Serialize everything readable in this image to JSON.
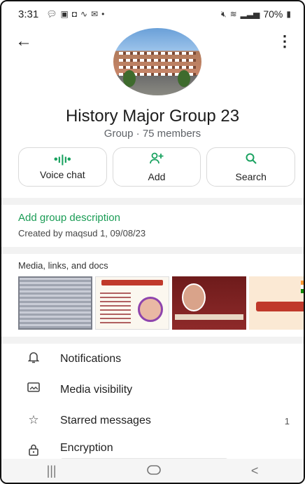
{
  "status_bar": {
    "time": "3:31",
    "notification_icons": [
      "chat-icon",
      "gallery-icon",
      "message-icon",
      "wifi-calling-icon",
      "mail-icon"
    ],
    "system_icons": [
      "mute-icon",
      "wifi-icon",
      "signal-icon"
    ],
    "battery": "70%"
  },
  "header": {
    "back_icon": "arrow-left-icon",
    "more_icon": "more-vertical-icon"
  },
  "group": {
    "name": "History Major Group 23",
    "info": "Group · 75 members"
  },
  "actions": [
    {
      "icon": "voice-wave-icon",
      "glyph": "•ı|ı•",
      "label": "Voice chat"
    },
    {
      "icon": "add-person-icon",
      "glyph": "+",
      "label": "Add"
    },
    {
      "icon": "search-icon",
      "glyph": "⚲",
      "label": "Search"
    }
  ],
  "description": {
    "link": "Add group description",
    "created": "Created by maqsud 1, 09/08/23"
  },
  "media": {
    "title": "Media, links, and docs",
    "thumbnails": [
      {
        "kind": "scanned-document"
      },
      {
        "kind": "poster",
        "caption": "Karim City College"
      },
      {
        "kind": "poster",
        "caption": "DR. JINDASI KUMARI"
      },
      {
        "kind": "poster"
      }
    ]
  },
  "settings": [
    {
      "icon": "bell-icon",
      "glyph": "🔔︎",
      "label": "Notifications",
      "count": ""
    },
    {
      "icon": "image-icon",
      "glyph": "▭",
      "label": "Media visibility",
      "count": ""
    },
    {
      "icon": "star-icon",
      "glyph": "☆",
      "label": "Starred messages",
      "count": "1"
    },
    {
      "icon": "lock-icon",
      "glyph": "🔒︎",
      "label": "Encryption",
      "count": ""
    }
  ],
  "nav": {
    "recents": "|||",
    "home": "○",
    "back": "<"
  },
  "colors": {
    "accent_green": "#1a9c55",
    "icon_green": "#1aa260"
  }
}
